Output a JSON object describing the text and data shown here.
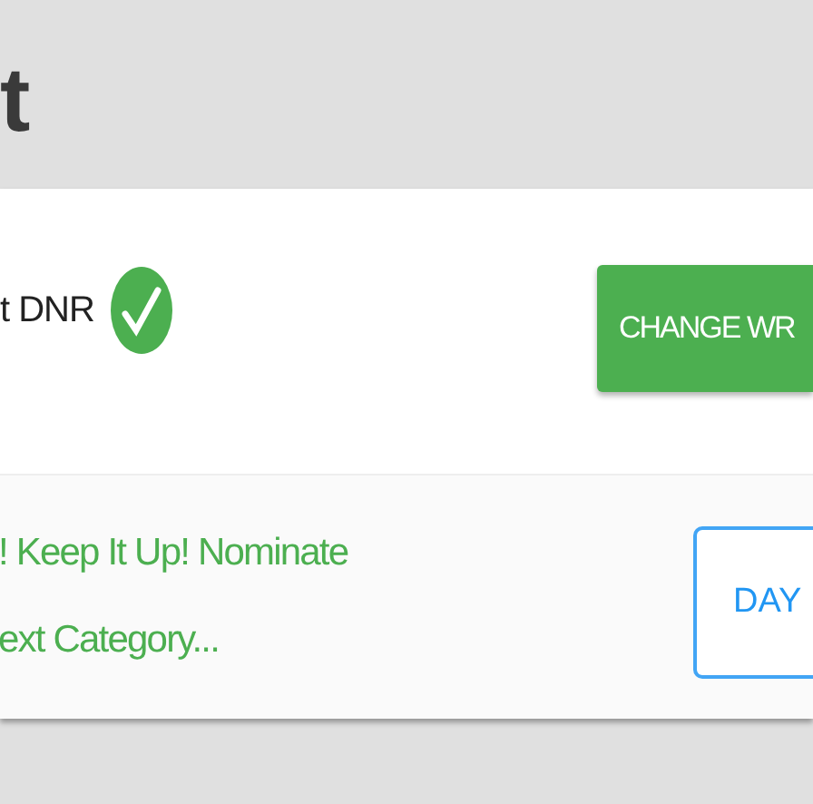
{
  "heading": "t",
  "status": {
    "label": "t DNR",
    "done": true
  },
  "change_button": "CHANGE WR",
  "message": {
    "lines": [
      "! Keep It Up! Nominate",
      "ext Category..."
    ]
  },
  "day_button": "DAY"
}
